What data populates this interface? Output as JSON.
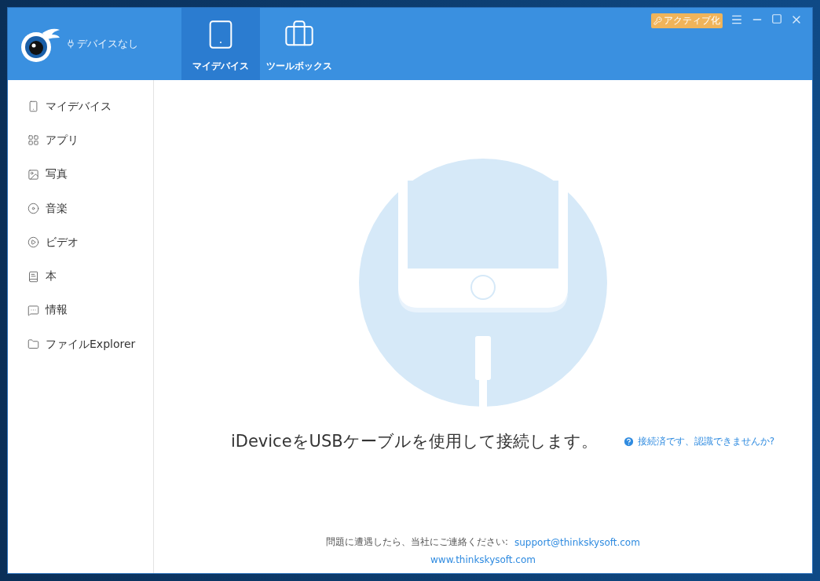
{
  "header": {
    "device_status": "デバイスなし",
    "activate_button": "アクティブ化"
  },
  "tabs": [
    {
      "label": "マイデバイス",
      "selected": true
    },
    {
      "label": "ツールボックス",
      "selected": false
    }
  ],
  "sidebar": {
    "items": [
      {
        "label": "マイデバイス"
      },
      {
        "label": "アプリ"
      },
      {
        "label": "写真"
      },
      {
        "label": "音楽"
      },
      {
        "label": "ビデオ"
      },
      {
        "label": "本"
      },
      {
        "label": "情報"
      },
      {
        "label": "ファイルExplorer"
      }
    ]
  },
  "main": {
    "message": "iDeviceをUSBケーブルを使用して接続します。",
    "help_link": "接続済です、認識できませんか?",
    "contact_text": "問題に遭遇したら、当社にご連絡ください:",
    "email": "support@thinkskysoft.com",
    "website": "www.thinkskysoft.com"
  }
}
